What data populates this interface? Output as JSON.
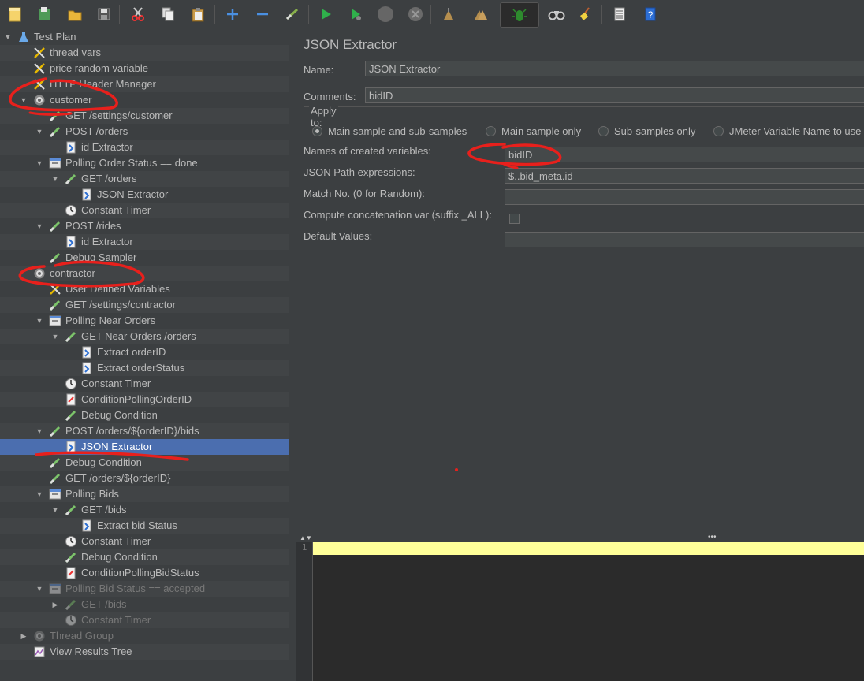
{
  "toolbar": {
    "buttons": [
      "new-icon",
      "templates-icon",
      "open-icon",
      "save-icon",
      "cut-icon",
      "copy-icon",
      "paste-icon",
      "expand-icon",
      "collapse-icon",
      "toggle-icon",
      "start-icon",
      "start-no-pause-icon",
      "stop-icon",
      "shutdown-icon",
      "clear-icon",
      "clear-all-icon",
      "search-icon",
      "reset-search-icon",
      "function-helper-icon",
      "help-icon"
    ]
  },
  "tree": [
    {
      "label": "Test Plan",
      "icon": "test-plan-icon"
    },
    {
      "label": "thread vars",
      "icon": "config-icon"
    },
    {
      "label": "price random variable",
      "icon": "config-icon"
    },
    {
      "label": "HTTP Header Manager",
      "icon": "config-icon"
    },
    {
      "label": "customer",
      "icon": "thread-group-icon"
    },
    {
      "label": "GET /settings/customer",
      "icon": "sampler-icon"
    },
    {
      "label": "POST /orders",
      "icon": "sampler-icon"
    },
    {
      "label": "id Extractor",
      "icon": "extractor-icon"
    },
    {
      "label": "Polling Order Status == done",
      "icon": "controller-icon"
    },
    {
      "label": "GET /orders",
      "icon": "sampler-icon"
    },
    {
      "label": "JSON Extractor",
      "icon": "extractor-icon"
    },
    {
      "label": "Constant Timer",
      "icon": "timer-icon"
    },
    {
      "label": "POST /rides",
      "icon": "sampler-icon"
    },
    {
      "label": "id Extractor",
      "icon": "extractor-icon"
    },
    {
      "label": "Debug Sampler",
      "icon": "sampler-icon"
    },
    {
      "label": "contractor",
      "icon": "thread-group-icon"
    },
    {
      "label": "User Defined Variables",
      "icon": "config-icon"
    },
    {
      "label": "GET /settings/contractor",
      "icon": "sampler-icon"
    },
    {
      "label": "Polling Near Orders",
      "icon": "controller-icon"
    },
    {
      "label": "GET Near Orders /orders",
      "icon": "sampler-icon"
    },
    {
      "label": "Extract orderID",
      "icon": "extractor-icon"
    },
    {
      "label": "Extract orderStatus",
      "icon": "extractor-icon"
    },
    {
      "label": "Constant Timer",
      "icon": "timer-icon"
    },
    {
      "label": "ConditionPollingOrderID",
      "icon": "postprocessor-icon"
    },
    {
      "label": "Debug Condition",
      "icon": "sampler-icon"
    },
    {
      "label": "POST /orders/${orderID}/bids",
      "icon": "sampler-icon"
    },
    {
      "label": "JSON Extractor",
      "icon": "extractor-icon"
    },
    {
      "label": "Debug Condition",
      "icon": "sampler-icon"
    },
    {
      "label": "GET /orders/${orderID}",
      "icon": "sampler-icon"
    },
    {
      "label": "Polling Bids",
      "icon": "controller-icon"
    },
    {
      "label": "GET /bids",
      "icon": "sampler-icon"
    },
    {
      "label": "Extract bid Status",
      "icon": "extractor-icon"
    },
    {
      "label": "Constant Timer",
      "icon": "timer-icon"
    },
    {
      "label": "Debug Condition",
      "icon": "sampler-icon"
    },
    {
      "label": "ConditionPollingBidStatus",
      "icon": "postprocessor-icon"
    },
    {
      "label": "Polling Bid Status == accepted",
      "icon": "controller-icon"
    },
    {
      "label": "GET /bids",
      "icon": "sampler-icon"
    },
    {
      "label": "Constant Timer",
      "icon": "timer-icon"
    },
    {
      "label": "Thread Group",
      "icon": "thread-group-icon"
    },
    {
      "label": "View Results Tree",
      "icon": "listener-icon"
    }
  ],
  "panel": {
    "title": "JSON Extractor",
    "name_label": "Name:",
    "name_value": "JSON Extractor",
    "comments_label": "Comments:",
    "comments_value": "bidID",
    "apply_to_label": "Apply to:",
    "apply_options": [
      "Main sample and sub-samples",
      "Main sample only",
      "Sub-samples only",
      "JMeter Variable Name to use"
    ],
    "apply_selected": "Main sample and sub-samples",
    "names_label": "Names of created variables:",
    "names_value": "bidID",
    "paths_label": "JSON Path expressions:",
    "paths_value": "$..bid_meta.id",
    "match_label": "Match No. (0 for Random):",
    "match_value": "",
    "concat_label": "Compute concatenation var (suffix _ALL):",
    "concat_checked": false,
    "default_label": "Default Values:",
    "default_value": ""
  },
  "editor": {
    "line_number": "1"
  },
  "colors": {
    "selection": "#4b6eaf",
    "annotation": "#e8201c",
    "current_line": "#ffff99"
  }
}
